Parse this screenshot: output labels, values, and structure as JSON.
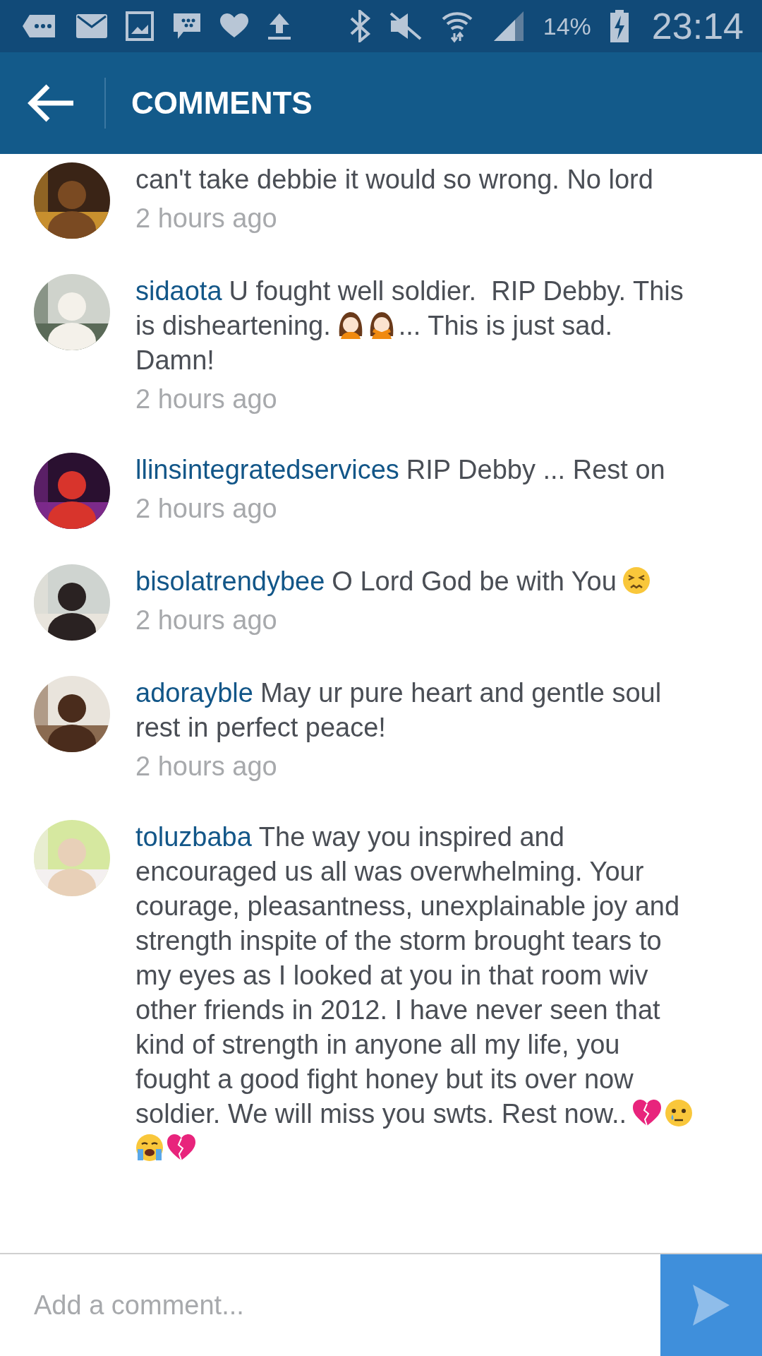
{
  "status_bar": {
    "battery": "14%",
    "time": "23:14"
  },
  "header": {
    "title": "COMMENTS"
  },
  "comments": [
    {
      "parts": [
        {
          "kind": "text",
          "text": "can't take debbie it would so wrong. No lord"
        }
      ],
      "time": "2 hours ago"
    },
    {
      "username": "sidaota",
      "parts": [
        {
          "kind": "text",
          "text": "U fought well soldier.  RIP Debby. This is disheartening."
        },
        {
          "kind": "girl"
        },
        {
          "kind": "girl-crossed"
        },
        {
          "kind": "text",
          "text": "... This is just sad.  Damn!"
        }
      ],
      "time": "2 hours ago"
    },
    {
      "username": "llinsintegratedservices",
      "parts": [
        {
          "kind": "text",
          "text": "RIP Debby ... Rest on"
        }
      ],
      "time": "2 hours ago"
    },
    {
      "username": "bisolatrendybee",
      "parts": [
        {
          "kind": "text",
          "text": "O Lord God be with You"
        },
        {
          "kind": "persevering"
        }
      ],
      "time": "2 hours ago"
    },
    {
      "username": "adorayble",
      "parts": [
        {
          "kind": "text",
          "text": "May ur pure heart and gentle soul rest in perfect peace!"
        }
      ],
      "time": "2 hours ago"
    },
    {
      "username": "toluzbaba",
      "parts": [
        {
          "kind": "text",
          "text": "The way you inspired and encouraged us all was overwhelming. Your courage, pleasantness, unexplainable joy and strength inspite of the storm brought tears to my eyes as I looked at you in that room wiv other friends in 2012. I have never seen that kind of strength in anyone all my life, you fought a good fight honey but its over now soldier. We will miss you swts. Rest now.."
        },
        {
          "kind": "broken-heart"
        },
        {
          "kind": "crying"
        },
        {
          "kind": "sobbing"
        },
        {
          "kind": "broken-heart"
        }
      ]
    }
  ],
  "composer": {
    "placeholder": "Add a comment..."
  }
}
